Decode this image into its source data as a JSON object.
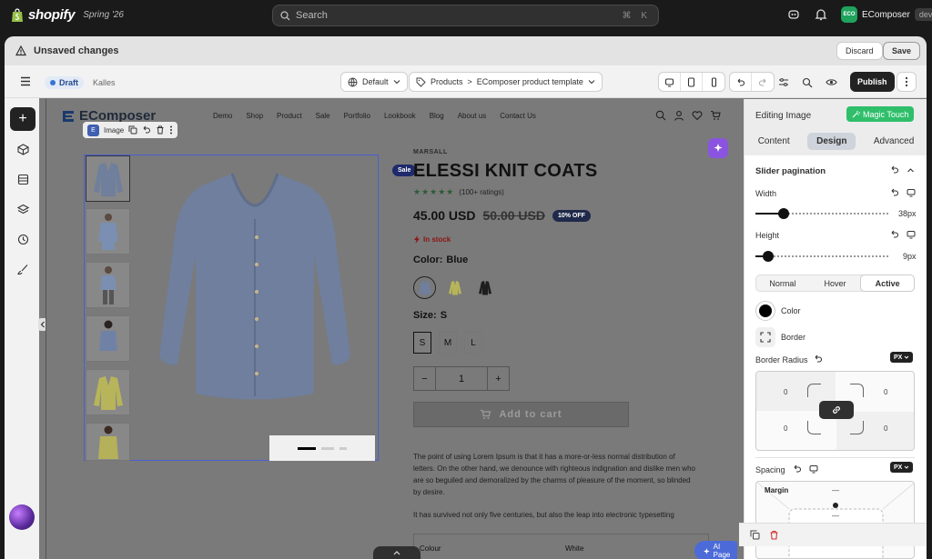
{
  "topbar": {
    "brand": "shopify",
    "edition": "Spring '26",
    "search_placeholder": "Search",
    "search_shortcut": "⌘ K",
    "store_avatar": "ECO",
    "store_name": "EComposer",
    "store_tag": "dev"
  },
  "unsaved": {
    "message": "Unsaved changes",
    "discard": "Discard",
    "save": "Save"
  },
  "toolbar": {
    "status": "Draft",
    "theme": "Kalles",
    "template_select": "Default",
    "breadcrumb_root": "Products",
    "breadcrumb_sep": ">",
    "breadcrumb_page": "EComposer product template",
    "publish": "Publish"
  },
  "canvas": {
    "site_logo": "EComposer",
    "nav": [
      "Demo",
      "Shop",
      "Product",
      "Sale",
      "Portfolio",
      "Lookbook",
      "Blog",
      "About us",
      "Contact Us"
    ],
    "element_toolbar_label": "Image",
    "element_toolbar_badge": "E",
    "sale_badge": "Sale",
    "product": {
      "vendor": "MARSALL",
      "title": "ELESSI KNIT COATS",
      "stars": "★★★★★",
      "ratings": "(100+ ratings)",
      "price": "45.00 USD",
      "old_price": "50.00 USD",
      "discount": "10% OFF",
      "stock": "In stock",
      "color_label": "Color:",
      "color_value": "Blue",
      "size_label": "Size:",
      "size_value": "S",
      "sizes": [
        "S",
        "M",
        "L"
      ],
      "qty_minus": "−",
      "qty_value": "1",
      "qty_plus": "+",
      "add_to_cart": "Add to cart",
      "description_1": "The point of using Lorem Ipsum is that it has a more-or-less normal distribution of letters. On the other hand, we denounce with righteous indignation and dislike men who are so beguiled and demoralized by the charms of pleasure of the moment, so blinded by desire.",
      "description_2": "It has survived not only five centuries, but also the leap into electronic typesetting",
      "spec_key": "Colour",
      "spec_value": "White"
    },
    "ai_page": "AI Page"
  },
  "panel": {
    "title": "Editing Image",
    "magic_touch": "Magic Touch",
    "tabs": [
      "Content",
      "Design",
      "Advanced"
    ],
    "active_tab": "Design",
    "section": "Slider pagination",
    "width_label": "Width",
    "width_value": "38px",
    "width_fraction": 0.19,
    "height_label": "Height",
    "height_value": "9px",
    "height_fraction": 0.06,
    "states": [
      "Normal",
      "Hover",
      "Active"
    ],
    "active_state": "Active",
    "color_label": "Color",
    "color_value": "#000000",
    "border_label": "Border",
    "radius_label": "Border Radius",
    "radius_unit": "PX",
    "radius_values": [
      "0",
      "0",
      "0",
      "0"
    ],
    "spacing_label": "Spacing",
    "spacing_unit": "PX",
    "margin_label": "Margin",
    "margin_top": "—",
    "margin_bottom": "—"
  },
  "colors": {
    "accent_green": "#2fbf6b",
    "draft_blue": "#3773d6",
    "magic_purple": "#8a54e0",
    "ai_blue": "#4c6bd8"
  }
}
